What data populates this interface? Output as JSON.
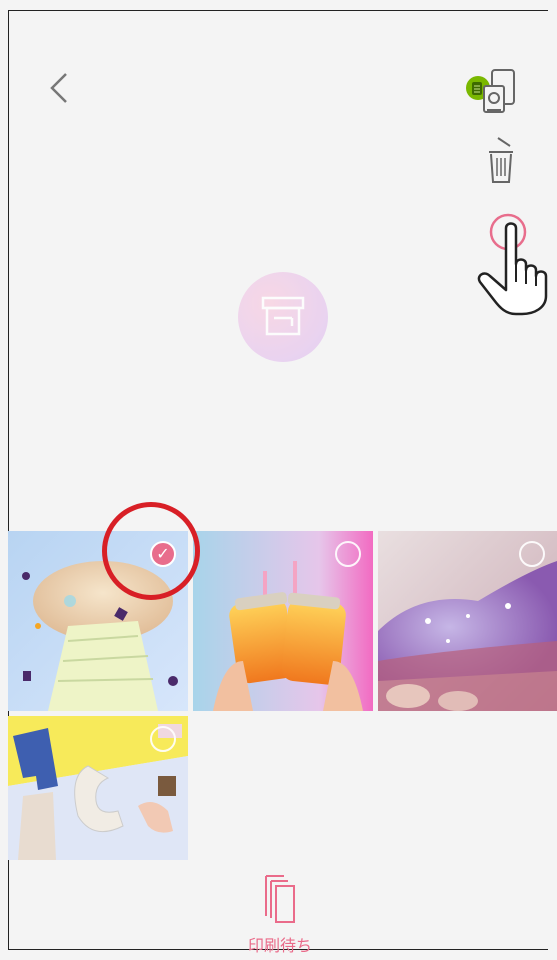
{
  "header": {
    "back_icon": "chevron-left-icon",
    "printer_icon": "printer-connection-icon",
    "delete_icon": "trash-icon",
    "select_icon": "select-circle-icon"
  },
  "print_button": {
    "icon": "print-icon"
  },
  "photos": [
    {
      "name": "photo-confetti-girl",
      "selected": true,
      "check": "✓"
    },
    {
      "name": "photo-juice-jars",
      "selected": false
    },
    {
      "name": "photo-glitter",
      "selected": false
    },
    {
      "name": "photo-letters-pc",
      "selected": false
    }
  ],
  "footer": {
    "queue_label": "印刷待ち",
    "queue_icon": "print-queue-icon"
  },
  "colors": {
    "accent": "#ea6b8a",
    "highlight": "#d81f26",
    "background": "#f4f4f4"
  }
}
